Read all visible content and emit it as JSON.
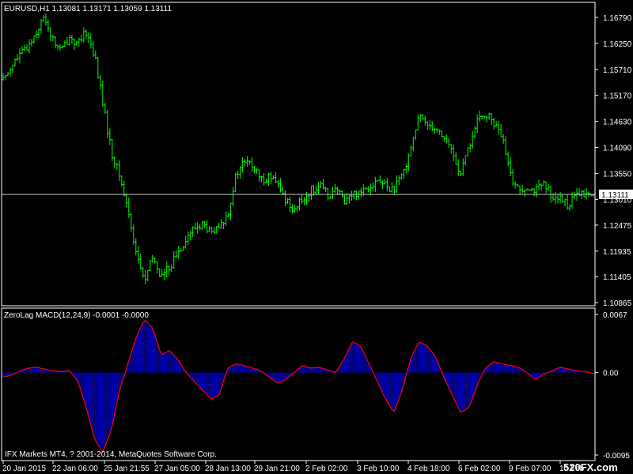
{
  "symbol_header": "EURUSD,H1  1.13081 1.13171 1.13059 1.13111",
  "indicator_header": "ZeroLag MACD(12,24,9) -0.0001 -0.0000",
  "copyright": "IFX Markets MT4, ? 2001-2014, MetaQuotes Software Corp.",
  "watermark": "520FX.com",
  "current_price_label": "1.13111",
  "colors": {
    "background": "#000000",
    "grid_frame": "#ffffff",
    "bar_up": "#00ff00",
    "histogram": "#0000aa",
    "signal_line": "#ff0000",
    "current_price_line": "#c0c0c0"
  },
  "chart_data": [
    {
      "type": "bar",
      "name": "price-panel",
      "y_ticks": [
        "1.16790",
        "1.16250",
        "1.15710",
        "1.15170",
        "1.14630",
        "1.14090",
        "1.13550",
        "1.13010",
        "1.12475",
        "1.11935",
        "1.11405",
        "1.10865"
      ],
      "y_range": [
        1.10865,
        1.171
      ],
      "current_price": 1.13111,
      "x_labels": [
        "20 Jan 2015",
        "22 Jan 06:00",
        "25 Jan 21:55",
        "27 Jan 05:00",
        "28 Jan 13:00",
        "29 Jan 21:00",
        "2 Feb 02:00",
        "3 Feb 10:00",
        "4 Feb 18:00",
        "6 Feb 02:00",
        "9 Feb 07:00",
        "10 Feb"
      ],
      "close_series": [
        1.155,
        1.158,
        1.16,
        1.162,
        1.165,
        1.168,
        1.163,
        1.161,
        1.164,
        1.162,
        1.165,
        1.16,
        1.15,
        1.14,
        1.135,
        1.128,
        1.119,
        1.113,
        1.118,
        1.114,
        1.116,
        1.119,
        1.122,
        1.124,
        1.125,
        1.123,
        1.124,
        1.127,
        1.135,
        1.138,
        1.137,
        1.134,
        1.135,
        1.133,
        1.13,
        1.128,
        1.13,
        1.132,
        1.133,
        1.131,
        1.132,
        1.13,
        1.131,
        1.132,
        1.133,
        1.134,
        1.133,
        1.132,
        1.135,
        1.141,
        1.147,
        1.146,
        1.145,
        1.143,
        1.14,
        1.135,
        1.141,
        1.146,
        1.148,
        1.146,
        1.143,
        1.135,
        1.132,
        1.133,
        1.132,
        1.133,
        1.131,
        1.13,
        1.129,
        1.131,
        1.131,
        1.131
      ]
    },
    {
      "type": "bar",
      "name": "macd-panel",
      "y_ticks": [
        "0.0067",
        "0.00",
        "-0.0095"
      ],
      "y_range": [
        -0.0095,
        0.0067
      ],
      "histogram": [
        -0.0005,
        -0.0003,
        0.0002,
        0.0005,
        0.0006,
        0.0004,
        0.0002,
        0.0001,
        0.0002,
        -0.001,
        -0.004,
        -0.0075,
        -0.009,
        -0.0065,
        -0.002,
        0.001,
        0.004,
        0.006,
        0.005,
        0.002,
        0.0025,
        0.0015,
        0.0,
        -0.001,
        -0.002,
        -0.003,
        -0.0025,
        0.0005,
        0.001,
        0.0008,
        0.0005,
        0.0002,
        -0.0005,
        -0.0012,
        -0.0008,
        0.0,
        0.0008,
        0.0005,
        0.0006,
        0.0003,
        0.0,
        0.0015,
        0.0035,
        0.003,
        0.001,
        -0.001,
        -0.003,
        -0.0045,
        -0.002,
        0.0015,
        0.0035,
        0.003,
        0.0018,
        -0.0005,
        -0.0025,
        -0.0045,
        -0.004,
        -0.0015,
        0.0005,
        0.0012,
        0.001,
        0.0008,
        0.0006,
        0.0,
        -0.0008,
        -0.0002,
        0.0002,
        0.0006,
        0.0004,
        0.0002,
        0.0001,
        -0.0001
      ]
    }
  ]
}
